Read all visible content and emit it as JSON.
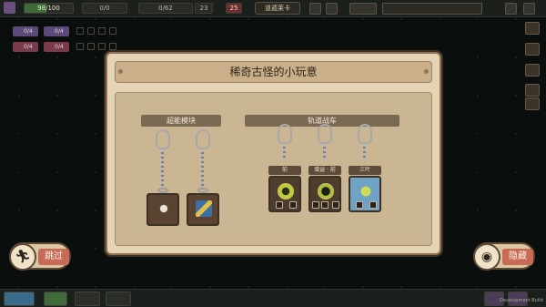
{
  "topbar": {
    "hp": "98/100",
    "resource_a": "0/0",
    "gems": "0/62",
    "gems_extra": "23",
    "badge": "25",
    "map_tab": "道遁莱卡"
  },
  "status": {
    "row1": [
      "0/4",
      "0/4"
    ],
    "row2": [
      "0/4",
      "0/4"
    ]
  },
  "dialog": {
    "title": "稀奇古怪的小玩意",
    "sections": [
      {
        "label": "超能模块"
      },
      {
        "label": "轨道战车"
      }
    ],
    "tags": [
      "前",
      "增益 · 前",
      "三叶"
    ]
  },
  "buttons": {
    "skip": "跳过",
    "hide": "隐藏"
  },
  "footer": {
    "dev_build": "Development Build"
  },
  "icons": {
    "skip_icon": "running-figure-icon",
    "hide_icon": "eye-icon"
  },
  "colors": {
    "panel": "#e4d3b4",
    "title_bar": "#c9b08a",
    "section_label": "#7a6a54",
    "button_label": "#c86b56"
  }
}
